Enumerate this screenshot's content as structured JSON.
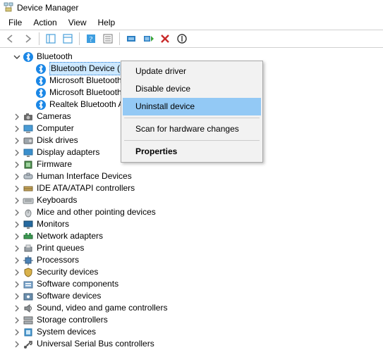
{
  "window": {
    "title": "Device Manager"
  },
  "menu": {
    "file": "File",
    "action": "Action",
    "view": "View",
    "help": "Help"
  },
  "tree": {
    "bluetooth": {
      "label": "Bluetooth",
      "children": [
        {
          "label": "Bluetooth Device (RFCOMM Protocol TDI)"
        },
        {
          "label": "Microsoft Bluetooth Enumerator"
        },
        {
          "label": "Microsoft Bluetooth LE Enumerator"
        },
        {
          "label": "Realtek Bluetooth Adapter"
        }
      ]
    },
    "categories": [
      {
        "label": "Cameras",
        "icon": "camera"
      },
      {
        "label": "Computer",
        "icon": "computer"
      },
      {
        "label": "Disk drives",
        "icon": "disk"
      },
      {
        "label": "Display adapters",
        "icon": "display"
      },
      {
        "label": "Firmware",
        "icon": "firmware"
      },
      {
        "label": "Human Interface Devices",
        "icon": "hid"
      },
      {
        "label": "IDE ATA/ATAPI controllers",
        "icon": "ide"
      },
      {
        "label": "Keyboards",
        "icon": "keyboard"
      },
      {
        "label": "Mice and other pointing devices",
        "icon": "mouse"
      },
      {
        "label": "Monitors",
        "icon": "monitor"
      },
      {
        "label": "Network adapters",
        "icon": "network"
      },
      {
        "label": "Print queues",
        "icon": "printer"
      },
      {
        "label": "Processors",
        "icon": "processor"
      },
      {
        "label": "Security devices",
        "icon": "security"
      },
      {
        "label": "Software components",
        "icon": "swcomp"
      },
      {
        "label": "Software devices",
        "icon": "swdev"
      },
      {
        "label": "Sound, video and game controllers",
        "icon": "sound"
      },
      {
        "label": "Storage controllers",
        "icon": "storage"
      },
      {
        "label": "System devices",
        "icon": "system"
      },
      {
        "label": "Universal Serial Bus controllers",
        "icon": "usb"
      }
    ]
  },
  "context_menu": {
    "update": "Update driver",
    "disable": "Disable device",
    "uninstall": "Uninstall device",
    "scan": "Scan for hardware changes",
    "properties": "Properties"
  }
}
